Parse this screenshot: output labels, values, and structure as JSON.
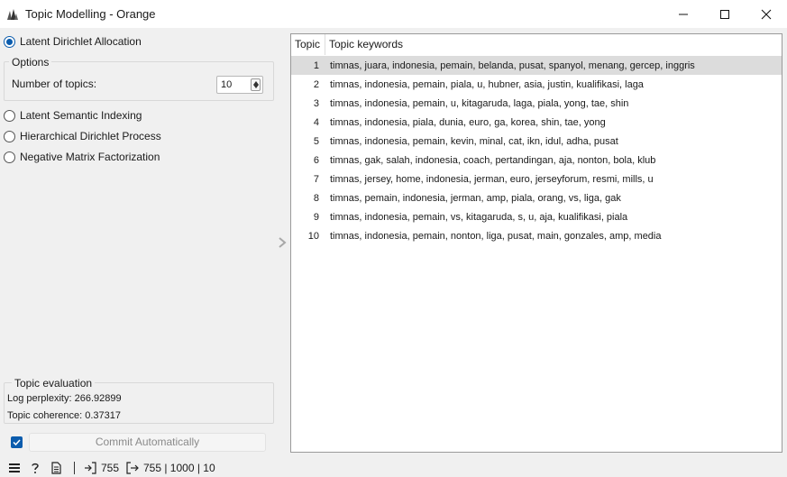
{
  "window": {
    "title": "Topic Modelling - Orange"
  },
  "methods": {
    "lda_label": "Latent Dirichlet Allocation",
    "lsi_label": "Latent Semantic Indexing",
    "hdp_label": "Hierarchical Dirichlet Process",
    "nmf_label": "Negative Matrix Factorization",
    "selected": "Latent Dirichlet Allocation"
  },
  "options": {
    "title": "Options",
    "num_topics_label": "Number of topics:",
    "num_topics_value": "10"
  },
  "evaluation": {
    "title": "Topic evaluation",
    "perplexity": "Log perplexity: 266.92899",
    "coherence": "Topic coherence: 0.37317"
  },
  "commit": {
    "label": "Commit Automatically",
    "auto_checked": true
  },
  "table": {
    "headers": [
      "Topic",
      "Topic keywords"
    ],
    "rows": [
      {
        "topic": "1",
        "keywords": "timnas, juara, indonesia, pemain, belanda, pusat, spanyol, menang, gercep, inggris"
      },
      {
        "topic": "2",
        "keywords": "timnas, indonesia, pemain, piala, u, hubner, asia, justin, kualifikasi, laga"
      },
      {
        "topic": "3",
        "keywords": "timnas, indonesia, pemain, u, kitagaruda, laga, piala, yong, tae, shin"
      },
      {
        "topic": "4",
        "keywords": "timnas, indonesia, piala, dunia, euro, ga, korea, shin, tae, yong"
      },
      {
        "topic": "5",
        "keywords": "timnas, indonesia, pemain, kevin, minal, cat, ikn, idul, adha, pusat"
      },
      {
        "topic": "6",
        "keywords": "timnas, gak, salah, indonesia, coach, pertandingan, aja, nonton, bola, klub"
      },
      {
        "topic": "7",
        "keywords": "timnas, jersey, home, indonesia, jerman, euro, jerseyforum, resmi, mills, u"
      },
      {
        "topic": "8",
        "keywords": "timnas, pemain, indonesia, jerman, amp, piala, orang, vs, liga, gak"
      },
      {
        "topic": "9",
        "keywords": "timnas, indonesia, pemain, vs, kitagaruda, s, u, aja, kualifikasi, piala"
      },
      {
        "topic": "10",
        "keywords": "timnas, indonesia, pemain, nonton, liga, pusat, main, gonzales, amp, media"
      }
    ],
    "selected_row": "1"
  },
  "status": {
    "input_count": "755",
    "output_summary": "755 | 1000 | 10"
  },
  "icons": {
    "app": "orange-app-icon",
    "minimize": "minimize-icon",
    "maximize": "maximize-icon",
    "close": "close-icon",
    "menu": "hamburger-menu-icon",
    "help": "help-icon",
    "report": "report-document-icon",
    "input": "input-data-icon",
    "output": "output-data-icon",
    "splitter": "chevron-right-icon"
  },
  "colors": {
    "accent": "#0b5cad",
    "selected_row": "#dcdcdc",
    "window_bg": "#f0f0f0"
  }
}
